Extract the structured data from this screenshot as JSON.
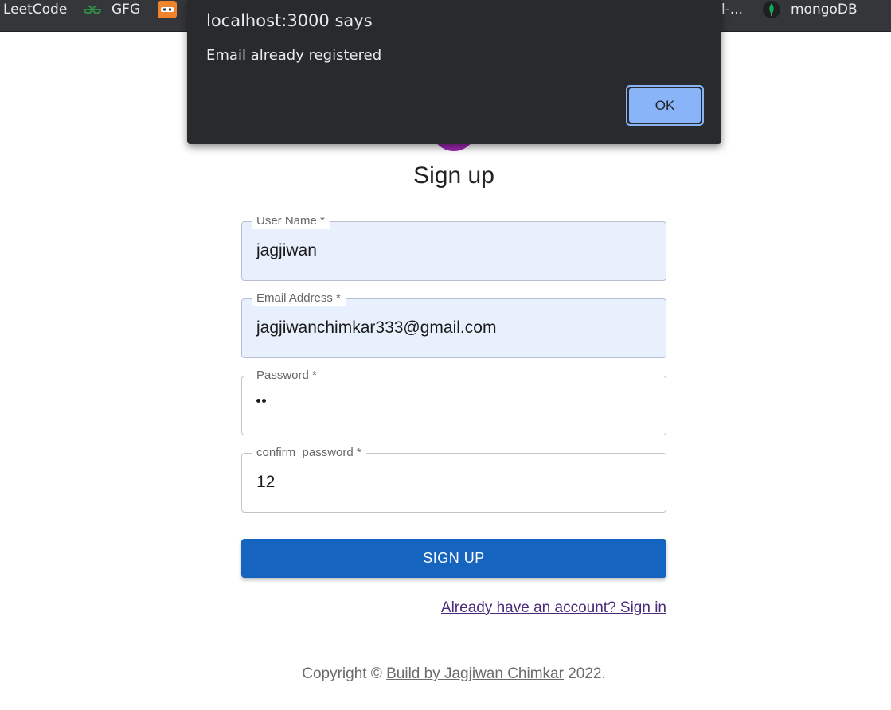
{
  "bookmarks": {
    "leetcode": "LeetCode",
    "gfg": "GFG",
    "gfg_icon": "ːGː",
    "truncated": "l-...",
    "mongodb": "mongoDB"
  },
  "alert": {
    "title": "localhost:3000 says",
    "message": "Email already registered",
    "ok_label": "OK"
  },
  "form": {
    "title": "Sign up",
    "username": {
      "label": "User Name *",
      "value": "jagjiwan"
    },
    "email": {
      "label": "Email Address *",
      "value": "jagjiwanchimkar333@gmail.com"
    },
    "password": {
      "label": "Password *",
      "masked_length": 2
    },
    "confirm_password": {
      "label": "confirm_password *",
      "value": "12"
    },
    "submit_label": "SIGN UP",
    "signin_link": "Already have an account? Sign in"
  },
  "footer": {
    "prefix": "Copyright ©",
    "link": "Build by Jagjiwan Chimkar",
    "suffix": "2022."
  },
  "colors": {
    "primary": "#1565c0",
    "avatar": "#9c27b0",
    "autofill": "#e8f0fe",
    "dialog_bg": "#292a2d",
    "ok_button": "#8ab4f8"
  }
}
